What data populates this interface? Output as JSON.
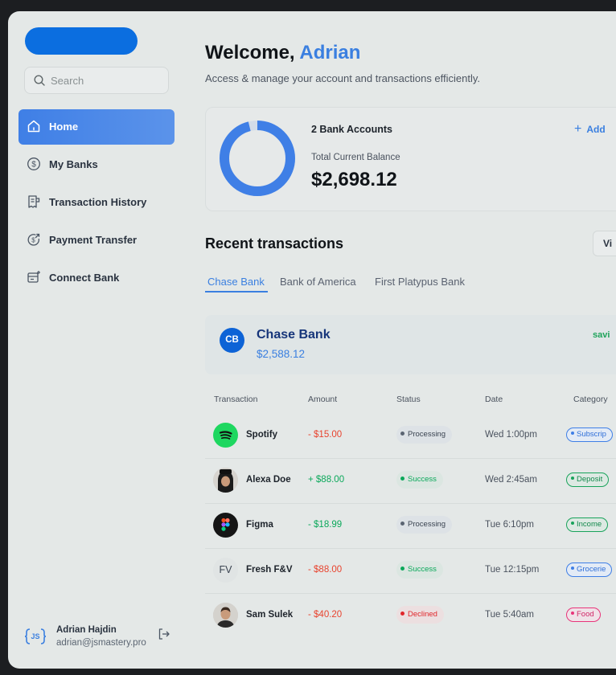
{
  "sidebar": {
    "search_placeholder": "Search",
    "items": [
      {
        "label": "Home",
        "icon": "home-icon",
        "active": true
      },
      {
        "label": "My Banks",
        "icon": "dollar-circle-icon"
      },
      {
        "label": "Transaction History",
        "icon": "receipt-icon"
      },
      {
        "label": "Payment Transfer",
        "icon": "transfer-icon"
      },
      {
        "label": "Connect Bank",
        "icon": "connect-bank-icon"
      }
    ],
    "user": {
      "badge": "JS MASTERY",
      "name": "Adrian Hajdin",
      "email": "adrian@jsmastery.pro"
    }
  },
  "header": {
    "welcome_prefix": "Welcome,",
    "welcome_name": "Adrian",
    "subtitle": "Access & manage your account and transactions efficiently."
  },
  "balance": {
    "accounts_label": "2 Bank Accounts",
    "total_label": "Total Current Balance",
    "total_amount": "$2,698.12",
    "add_label": "Add",
    "donut_share": 0.96
  },
  "recent": {
    "title": "Recent transactions",
    "view_all": "Vi",
    "tabs": [
      "Chase Bank",
      "Bank of America",
      "First Platypus Bank"
    ],
    "bank": {
      "initials": "CB",
      "name": "Chase Bank",
      "balance": "$2,588.12",
      "type": "savi"
    }
  },
  "table": {
    "headers": [
      "Transaction",
      "Amount",
      "Status",
      "Date",
      "Category"
    ],
    "rows": [
      {
        "name": "Spotify",
        "amount": "- $15.00",
        "status": "Processing",
        "date": "Wed 1:00pm",
        "category": "Subscrip"
      },
      {
        "name": "Alexa Doe",
        "amount": "+ $88.00",
        "status": "Success",
        "date": "Wed 2:45am",
        "category": "Deposit"
      },
      {
        "name": "Figma",
        "amount": "- $18.99",
        "status": "Processing",
        "date": "Tue 6:10pm",
        "category": "Income"
      },
      {
        "name": "Fresh F&V",
        "initials": "FV",
        "amount": "- $88.00",
        "status": "Success",
        "date": "Tue 12:15pm",
        "category": "Grocerie"
      },
      {
        "name": "Sam Sulek",
        "amount": "- $40.20",
        "status": "Declined",
        "date": "Tue 5:40am",
        "category": "Food"
      }
    ]
  },
  "colors": {
    "accent": "#3a7fe0",
    "negative": "#e8432e",
    "positive": "#0aa85a",
    "declined": "#e0262b"
  }
}
